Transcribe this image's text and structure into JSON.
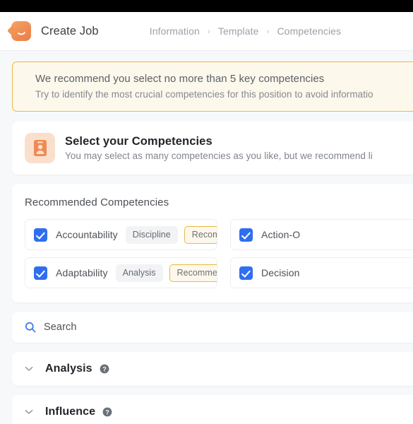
{
  "statusbar": {
    "name": "system-status-bar"
  },
  "header": {
    "logo_name": "app-logo-icon",
    "app_title": "Create Job",
    "breadcrumb": [
      {
        "label": "Information",
        "active": false
      },
      {
        "label": "Template",
        "active": false
      },
      {
        "label": "Competencies",
        "active": true
      }
    ],
    "separator": "›"
  },
  "banner": {
    "title": "We recommend you select no more than 5 key competencies",
    "subtitle": "Try to identify the most crucial competencies for this position to avoid informatio",
    "border_color": "#e8b845",
    "background_color": "#fdf8ec"
  },
  "select_card": {
    "icon": "id-badge-icon",
    "title": "Select your Competencies",
    "subtitle": "You may select as many competencies as you like, but we recommend li"
  },
  "recommended": {
    "heading": "Recommended Competencies",
    "items": [
      {
        "name": "Accountability",
        "checked": true,
        "category_tag": "Discipline",
        "recommended_tag": "Recommended"
      },
      {
        "name": "Action-O",
        "checked": true,
        "category_tag": "",
        "recommended_tag": ""
      },
      {
        "name": "Adaptability",
        "checked": true,
        "category_tag": "Analysis",
        "recommended_tag": "Recommended"
      },
      {
        "name": "Decision",
        "checked": true,
        "category_tag": "",
        "recommended_tag": ""
      }
    ]
  },
  "search": {
    "icon": "search-icon",
    "value": "",
    "placeholder": "Search",
    "icon_color": "#2f6ef0"
  },
  "accordions": [
    {
      "title": "Analysis",
      "chevron": "chevron-down-icon",
      "help": "help-circle-icon",
      "expanded": false
    },
    {
      "title": "Influence",
      "chevron": "chevron-down-icon",
      "help": "help-circle-icon",
      "expanded": false
    }
  ],
  "colors": {
    "accent_blue": "#2f6ef0",
    "brand_orange": "#ef8a52",
    "warning_amber": "#e8b845",
    "page_background": "#f7f8fa"
  }
}
